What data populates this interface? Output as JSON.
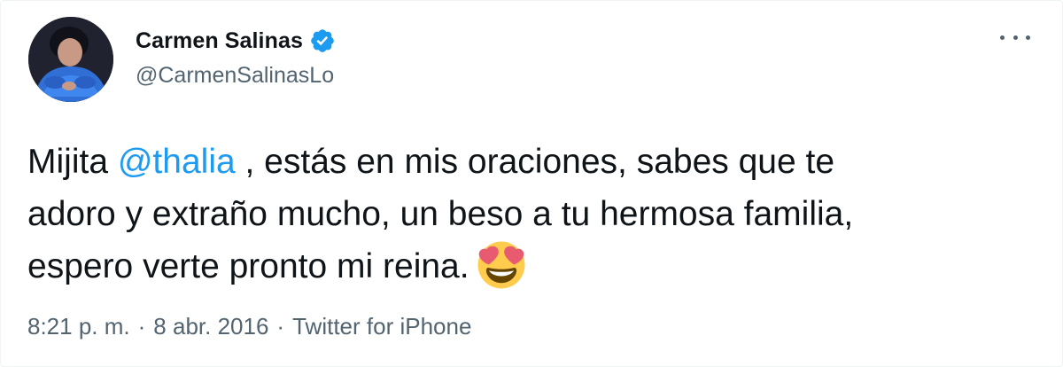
{
  "author": {
    "name": "Carmen Salinas",
    "handle": "@CarmenSalinasLo",
    "verified": true
  },
  "tweet": {
    "text_before": "Mijita ",
    "mention": "@thalia",
    "line1_rest": " , estás en mis oraciones, sabes que te",
    "line2": "adoro y extraño mucho, un beso a tu hermosa familia,",
    "line3": "espero verte pronto mi reina.",
    "emoji": "smiling-face-with-heart-eyes"
  },
  "meta": {
    "time": "8:21 p. m.",
    "separator": "·",
    "date": "8 abr. 2016",
    "source": "Twitter for iPhone"
  },
  "colors": {
    "accent": "#1d9bf0",
    "secondary_text": "#536471",
    "primary_text": "#0f1419"
  }
}
